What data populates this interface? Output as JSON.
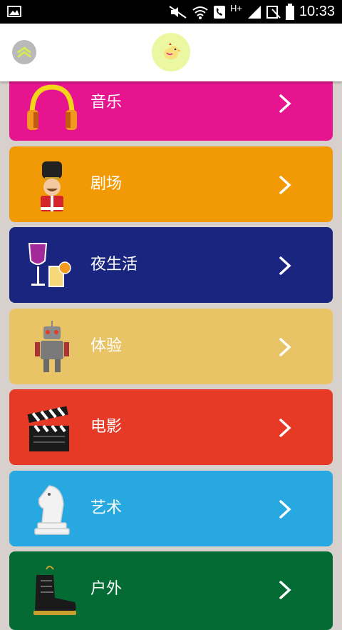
{
  "status_bar": {
    "time": "10:33",
    "network": "H+"
  },
  "header": {
    "collapse_icon": "double-chevron-up-icon",
    "logo_icon": "bird-logo-icon"
  },
  "categories": [
    {
      "label": "音乐",
      "color": "#e6158f",
      "icon": "headphones-icon"
    },
    {
      "label": "剧场",
      "color": "#f19a06",
      "icon": "toy-soldier-icon"
    },
    {
      "label": "夜生活",
      "color": "#1a2580",
      "icon": "drinks-icon"
    },
    {
      "label": "体验",
      "color": "#e9c466",
      "icon": "robot-icon"
    },
    {
      "label": "电影",
      "color": "#e63a27",
      "icon": "clapperboard-icon"
    },
    {
      "label": "艺术",
      "color": "#27a8e0",
      "icon": "chess-knight-icon"
    },
    {
      "label": "户外",
      "color": "#056b35",
      "icon": "boot-icon"
    }
  ]
}
